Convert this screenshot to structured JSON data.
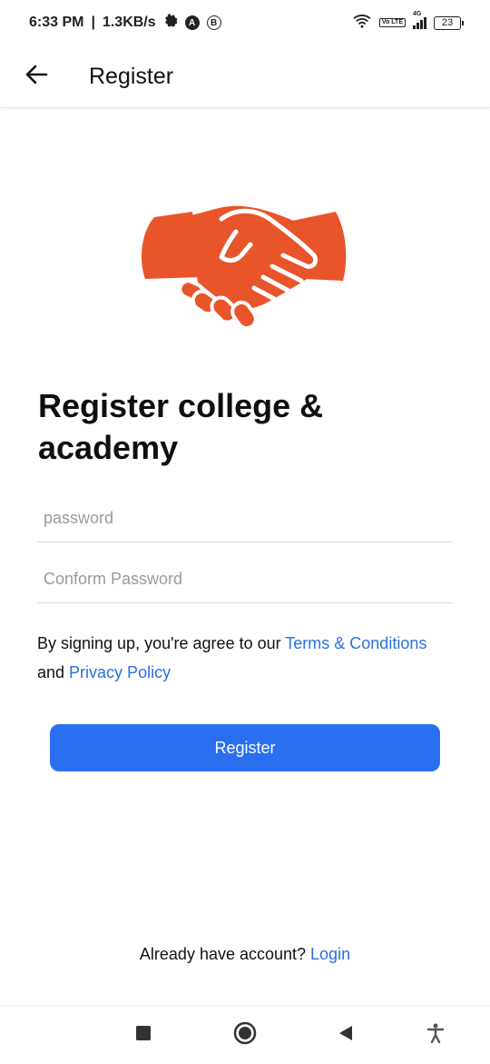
{
  "status_bar": {
    "time": "6:33 PM",
    "network_speed": "1.3KB/s",
    "badge_a": "A",
    "badge_b": "B",
    "volte_label": "Vo LTE",
    "signal_label": "4G",
    "battery": "23"
  },
  "app_bar": {
    "title": "Register",
    "back_icon": "arrow-left-icon"
  },
  "hero": {
    "icon": "handshake-icon",
    "color": "#E8552A"
  },
  "headline": {
    "line1": "Register college &",
    "line2": "academy"
  },
  "form": {
    "password_placeholder": "password",
    "confirm_placeholder": "Conform Password"
  },
  "terms": {
    "prefix": "By signing up, you're agree to our ",
    "terms_link": "Terms & Conditions",
    "and_text": "and ",
    "privacy_link": "Privacy Policy"
  },
  "register_button": {
    "label": "Register",
    "color": "#2A6FF0"
  },
  "login_row": {
    "text": "Already have account? ",
    "link": "Login"
  },
  "nav_bar": {
    "recents_icon": "square-icon",
    "home_icon": "circle-home-icon",
    "back_icon": "triangle-back-icon",
    "accessibility_icon": "accessibility-icon"
  },
  "colors": {
    "accent": "#2A6FF0",
    "link": "#2B6FE0",
    "brand_orange": "#E8552A"
  }
}
